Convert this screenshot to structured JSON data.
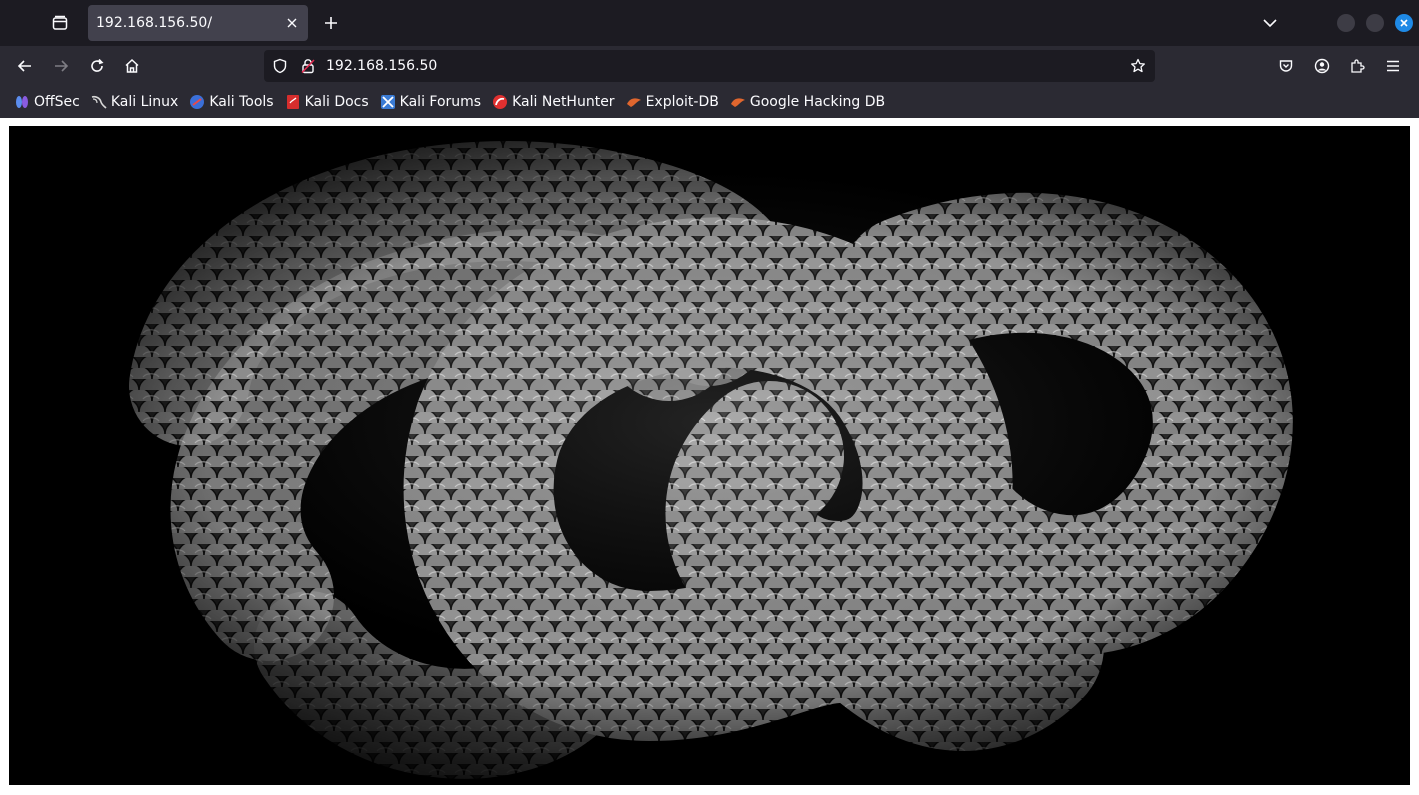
{
  "tab": {
    "title": "192.168.156.50/"
  },
  "urlbar": {
    "url": "192.168.156.50"
  },
  "bookmarks": [
    {
      "label": "OffSec",
      "icon": "offsec-icon",
      "color": "#5b8def"
    },
    {
      "label": "Kali Linux",
      "icon": "kali-dragon-icon",
      "color": "#111111"
    },
    {
      "label": "Kali Tools",
      "icon": "kali-tools-icon",
      "color": "#3b6fd8"
    },
    {
      "label": "Kali Docs",
      "icon": "kali-docs-icon",
      "color": "#d62d2d"
    },
    {
      "label": "Kali Forums",
      "icon": "kali-forums-icon",
      "color": "#3a7bd5"
    },
    {
      "label": "Kali NetHunter",
      "icon": "nethunter-icon",
      "color": "#e03030"
    },
    {
      "label": "Exploit-DB",
      "icon": "exploit-db-icon",
      "color": "#e0662e"
    },
    {
      "label": "Google Hacking DB",
      "icon": "ghdb-icon",
      "color": "#e0662e"
    }
  ],
  "content": {
    "image": "coiled-snake-image"
  },
  "colors": {
    "accent": "#1f8ae6",
    "toolbar": "#2b2a33",
    "tabstrip": "#1c1b22"
  }
}
